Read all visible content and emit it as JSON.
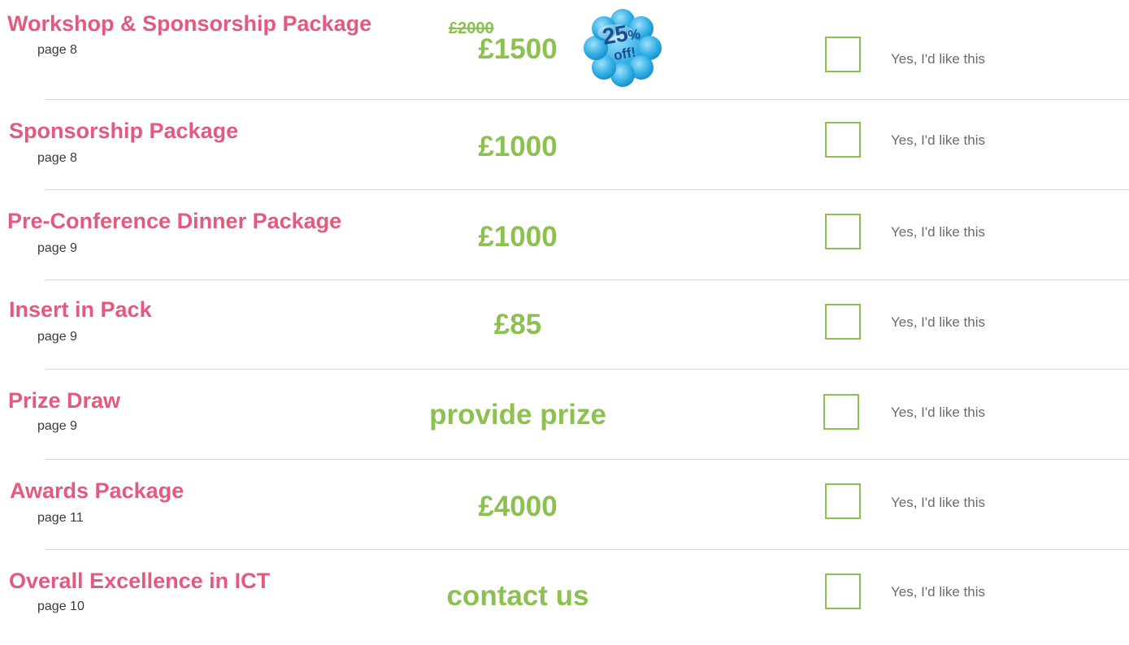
{
  "packages": [
    {
      "title": "Workshop & Sponsorship Package",
      "page": "page 8",
      "price": "£1500",
      "old_price": "£2000",
      "badge": {
        "percent": "25",
        "percent_sign": "%",
        "off": "off!"
      },
      "option_label": "Yes, I'd like this"
    },
    {
      "title": "Sponsorship Package",
      "page": "page 8",
      "price": "£1000",
      "option_label": "Yes, I'd like this"
    },
    {
      "title": "Pre-Conference Dinner Package",
      "page": "page 9",
      "price": "£1000",
      "option_label": "Yes, I'd like this"
    },
    {
      "title": "Insert in Pack",
      "page": "page 9",
      "price": "£85",
      "option_label": "Yes, I'd like this"
    },
    {
      "title": "Prize Draw",
      "page": "page 9",
      "price": "provide prize",
      "option_label": "Yes, I'd like this"
    },
    {
      "title": "Awards Package",
      "page": "page 11",
      "price": "£4000",
      "option_label": "Yes, I'd like this"
    },
    {
      "title": "Overall Excellence in ICT",
      "page": "page 10",
      "price": "contact us",
      "option_label": "Yes, I'd like this"
    }
  ],
  "colors": {
    "title": "#e35a7e",
    "price": "#8cc152",
    "checkbox_border": "#8cc152",
    "label": "#6b6b6b",
    "badge_fill": "#33b0e6",
    "badge_text": "#1d4c8c"
  }
}
